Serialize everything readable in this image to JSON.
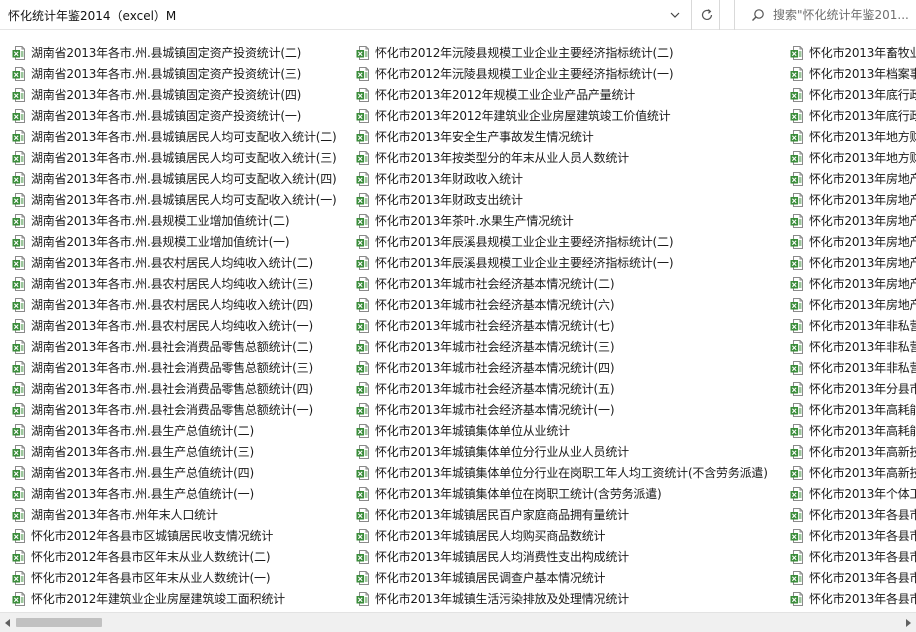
{
  "address_bar": {
    "path": "怀化统计年鉴2014（excel）M"
  },
  "search": {
    "placeholder": "搜索\"怀化统计年鉴201..."
  },
  "icons": {
    "file": "excel-file-icon",
    "dropdown": "chevron-down-icon",
    "refresh": "refresh-icon",
    "search": "search-icon",
    "scroll_left": "scroll-left-arrow-icon",
    "scroll_right": "scroll-right-arrow-icon"
  },
  "colors": {
    "icon_green": "#3a8c3a",
    "scroll_thumb": "#c1c1c1"
  },
  "files": {
    "col1": [
      "湖南省2013年各市.州.县城镇固定资产投资统计(二)",
      "湖南省2013年各市.州.县城镇固定资产投资统计(三)",
      "湖南省2013年各市.州.县城镇固定资产投资统计(四)",
      "湖南省2013年各市.州.县城镇固定资产投资统计(一)",
      "湖南省2013年各市.州.县城镇居民人均可支配收入统计(二)",
      "湖南省2013年各市.州.县城镇居民人均可支配收入统计(三)",
      "湖南省2013年各市.州.县城镇居民人均可支配收入统计(四)",
      "湖南省2013年各市.州.县城镇居民人均可支配收入统计(一)",
      "湖南省2013年各市.州.县规模工业增加值统计(二)",
      "湖南省2013年各市.州.县规模工业增加值统计(一)",
      "湖南省2013年各市.州.县农村居民人均纯收入统计(二)",
      "湖南省2013年各市.州.县农村居民人均纯收入统计(三)",
      "湖南省2013年各市.州.县农村居民人均纯收入统计(四)",
      "湖南省2013年各市.州.县农村居民人均纯收入统计(一)",
      "湖南省2013年各市.州.县社会消费品零售总额统计(二)",
      "湖南省2013年各市.州.县社会消费品零售总额统计(三)",
      "湖南省2013年各市.州.县社会消费品零售总额统计(四)",
      "湖南省2013年各市.州.县社会消费品零售总额统计(一)",
      "湖南省2013年各市.州.县生产总值统计(二)",
      "湖南省2013年各市.州.县生产总值统计(三)",
      "湖南省2013年各市.州.县生产总值统计(四)",
      "湖南省2013年各市.州.县生产总值统计(一)",
      "湖南省2013年各市.州年末人口统计",
      "怀化市2012年各县市区城镇居民收支情况统计",
      "怀化市2012年各县市区年末从业人数统计(二)",
      "怀化市2012年各县市区年末从业人数统计(一)",
      "怀化市2012年建筑业企业房屋建筑竣工面积统计"
    ],
    "col2": [
      "怀化市2012年沅陵县规模工业企业主要经济指标统计(二)",
      "怀化市2012年沅陵县规模工业企业主要经济指标统计(一)",
      "怀化市2013年2012年规模工业企业产品产量统计",
      "怀化市2013年2012年建筑业企业房屋建筑竣工价值统计",
      "怀化市2013年安全生产事故发生情况统计",
      "怀化市2013年按类型分的年末从业人员人数统计",
      "怀化市2013年财政收入统计",
      "怀化市2013年财政支出统计",
      "怀化市2013年茶叶.水果生产情况统计",
      "怀化市2013年辰溪县规模工业企业主要经济指标统计(二)",
      "怀化市2013年辰溪县规模工业企业主要经济指标统计(一)",
      "怀化市2013年城市社会经济基本情况统计(二)",
      "怀化市2013年城市社会经济基本情况统计(六)",
      "怀化市2013年城市社会经济基本情况统计(七)",
      "怀化市2013年城市社会经济基本情况统计(三)",
      "怀化市2013年城市社会经济基本情况统计(四)",
      "怀化市2013年城市社会经济基本情况统计(五)",
      "怀化市2013年城市社会经济基本情况统计(一)",
      "怀化市2013年城镇集体单位从业统计",
      "怀化市2013年城镇集体单位分行业从业人员统计",
      "怀化市2013年城镇集体单位分行业在岗职工年人均工资统计(不含劳务派遣)",
      "怀化市2013年城镇集体单位在岗职工统计(含劳务派遣)",
      "怀化市2013年城镇居民百户家庭商品拥有量统计",
      "怀化市2013年城镇居民人均购买商品数统计",
      "怀化市2013年城镇居民人均消费性支出构成统计",
      "怀化市2013年城镇居民调查户基本情况统计",
      "怀化市2013年城镇生活污染排放及处理情况统计"
    ],
    "col3": [
      "怀化市2013年畜牧业",
      "怀化市2013年档案事",
      "怀化市2013年底行政",
      "怀化市2013年底行政",
      "怀化市2013年地方财",
      "怀化市2013年地方财",
      "怀化市2013年房地产",
      "怀化市2013年房地产",
      "怀化市2013年房地产",
      "怀化市2013年房地产",
      "怀化市2013年房地产",
      "怀化市2013年房地产",
      "怀化市2013年房地产",
      "怀化市2013年非私营",
      "怀化市2013年非私营",
      "怀化市2013年非私营",
      "怀化市2013年分县市",
      "怀化市2013年高耗能",
      "怀化市2013年高耗能",
      "怀化市2013年高新技",
      "怀化市2013年高新技",
      "怀化市2013年个体工",
      "怀化市2013年各县市",
      "怀化市2013年各县市",
      "怀化市2013年各县市",
      "怀化市2013年各县市",
      "怀化市2013年各县市"
    ]
  }
}
